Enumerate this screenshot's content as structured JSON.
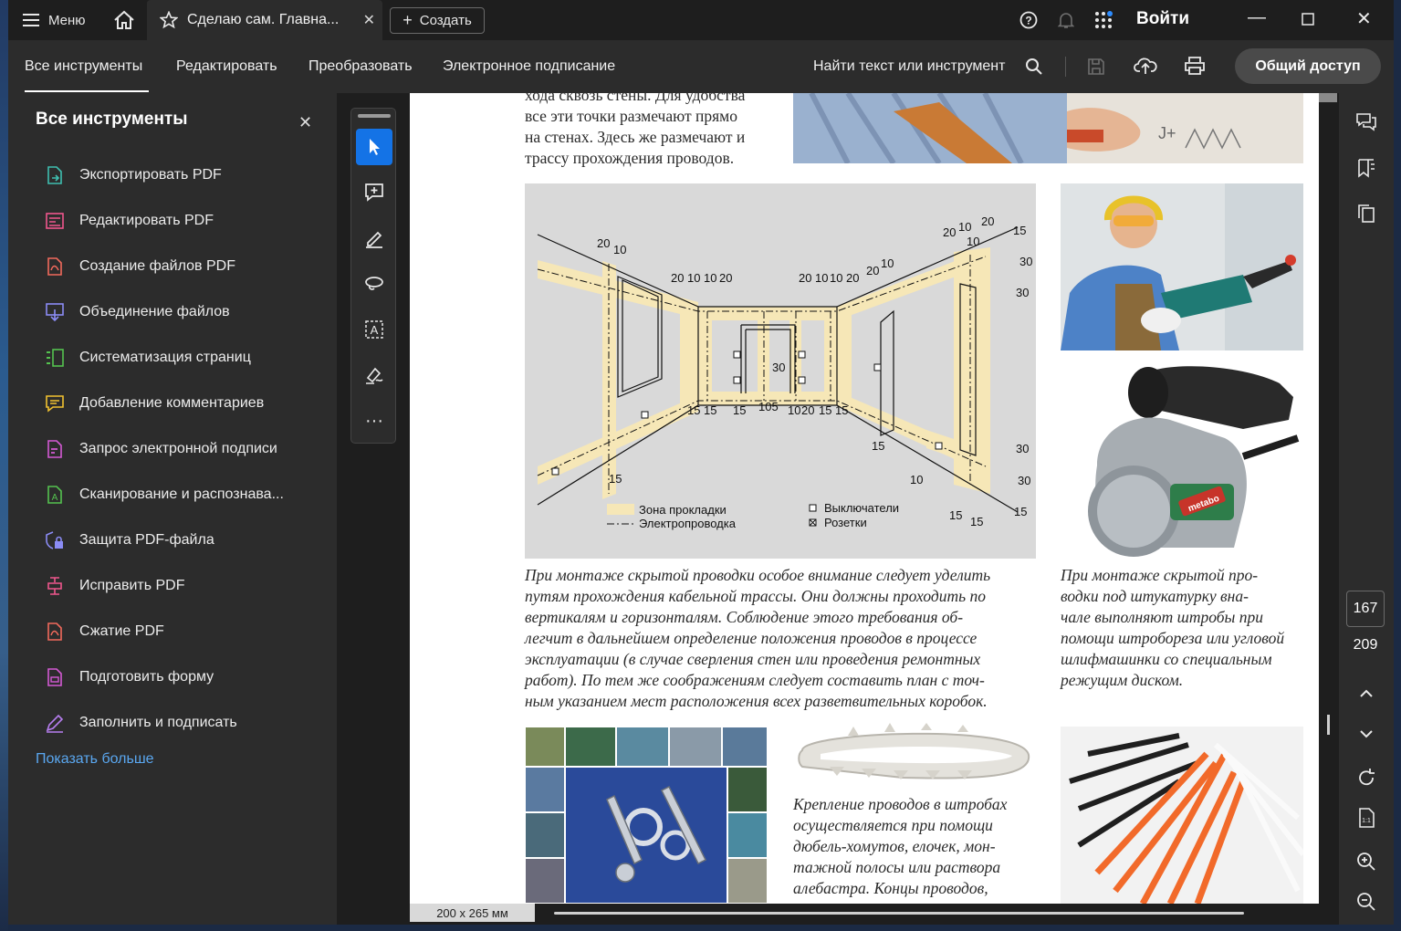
{
  "titlebar": {
    "menu_label": "Меню",
    "tab_title": "Сделаю сам. Главна...",
    "create_label": "Создать",
    "login_label": "Войти"
  },
  "navbar": {
    "tabs": [
      "Все инструменты",
      "Редактировать",
      "Преобразовать",
      "Электронное подписание"
    ],
    "find_label": "Найти текст или инструмент",
    "share_label": "Общий доступ"
  },
  "left_panel": {
    "title": "Все инструменты",
    "items": [
      {
        "label": "Экспортировать PDF",
        "icon": "export-pdf-icon",
        "color": "#3fbfb0"
      },
      {
        "label": "Редактировать PDF",
        "icon": "edit-pdf-icon",
        "color": "#f0568d"
      },
      {
        "label": "Создание файлов PDF",
        "icon": "create-pdf-icon",
        "color": "#f26a5c"
      },
      {
        "label": "Объединение файлов",
        "icon": "combine-files-icon",
        "color": "#8b8cf5"
      },
      {
        "label": "Систематизация страниц",
        "icon": "organize-pages-icon",
        "color": "#54c24f"
      },
      {
        "label": "Добавление комментариев",
        "icon": "comment-icon",
        "color": "#f2c230"
      },
      {
        "label": "Запрос электронной подписи",
        "icon": "request-signature-icon",
        "color": "#d45ad4"
      },
      {
        "label": "Сканирование и распознава...",
        "icon": "scan-ocr-icon",
        "color": "#54c24f"
      },
      {
        "label": "Защита PDF-файла",
        "icon": "protect-pdf-icon",
        "color": "#8b8cf5"
      },
      {
        "label": "Исправить PDF",
        "icon": "fix-pdf-icon",
        "color": "#f0568d"
      },
      {
        "label": "Сжатие PDF",
        "icon": "compress-pdf-icon",
        "color": "#f26a5c"
      },
      {
        "label": "Подготовить форму",
        "icon": "prepare-form-icon",
        "color": "#d45ad4"
      },
      {
        "label": "Заполнить и подписать",
        "icon": "fill-sign-icon",
        "color": "#b77ef0"
      }
    ],
    "show_more": "Показать больше"
  },
  "document": {
    "top_text": [
      "хода сквозь стены. Для удобства",
      "все эти точки размечают прямо",
      "на стенах. Здесь же размечают и",
      "трассу прохождения проводов."
    ],
    "diagram_legend": {
      "zone": "Зона прокладки",
      "wiring": "Электропроводка",
      "switches": "Выключатели",
      "sockets": "Розетки"
    },
    "diagram_numbers": [
      "20",
      "10",
      "20",
      "10",
      "10",
      "20",
      "20",
      "10",
      "10",
      "20",
      "20",
      "10",
      "20",
      "10",
      "20",
      "15",
      "30",
      "30",
      "30",
      "15",
      "15",
      "15",
      "105",
      "10",
      "20",
      "15",
      "15",
      "15",
      "10",
      "30",
      "30",
      "15",
      "15",
      "15"
    ],
    "caption_main": [
      "При монтаже скрытой проводки особое внимание следует уделить",
      "путям прохождения кабельной трассы. Они должны проходить по",
      "вертикалям и горизонталям. Соблюдение этого требования об-",
      "легчит в дальнейшем определение положения проводов в процессе",
      "эксплуатации (в случае сверления стен или проведения ремонтных",
      "работ). По тем же соображениям следует составить план с точ-",
      "ным указанием мест расположения всех разветвительных коробок."
    ],
    "caption_right": [
      "При монтаже скрытой про-",
      "водки под штукатурку вна-",
      "чале выполняют штробы при",
      "помощи штробореза или угловой",
      "шлифмашинки со специальным",
      "режущим диском."
    ],
    "caption_bottom": [
      "Крепление проводов в штробах",
      "осуществляется при помощи",
      "дюбель-хомутов, елочек, мон-",
      "тажной полосы или раствора",
      "алебастра. Концы проводов,"
    ],
    "tool_brand": "metabo"
  },
  "status": {
    "page_size": "200 x 265 мм"
  },
  "pager": {
    "current": "167",
    "total": "209"
  }
}
